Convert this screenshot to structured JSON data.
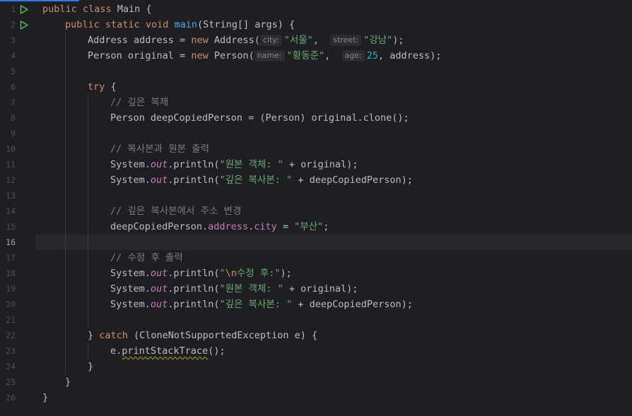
{
  "editor": {
    "accent_color": "#3574f0",
    "current_line": 16,
    "line_numbers": [
      "1",
      "2",
      "3",
      "4",
      "5",
      "6",
      "7",
      "8",
      "9",
      "10",
      "11",
      "12",
      "13",
      "14",
      "15",
      "16",
      "17",
      "18",
      "19",
      "20",
      "21",
      "22",
      "23",
      "24",
      "25",
      "26"
    ],
    "run_gutter_icons": [
      "run-class-icon",
      "run-main-icon"
    ],
    "lines": {
      "l1": {
        "kw1": "public",
        "kw2": "class",
        "name": "Main",
        "brace": " {"
      },
      "l2": {
        "kw1": "public",
        "kw2": "static",
        "kw3": "void",
        "fn": "main",
        "params": "(String[] args) {"
      },
      "l3": {
        "a": "Address address = ",
        "kw": "new",
        "b": " Address(",
        "hint1": "city:",
        "s1": "\"서울\"",
        "c": ", ",
        "hint2": "street:",
        "s2": "\"강남\"",
        "d": ");"
      },
      "l4": {
        "a": "Person original = ",
        "kw": "new",
        "b": " Person(",
        "hint1": "name:",
        "s1": "\"황동준\"",
        "c": ", ",
        "hint2": "age:",
        "n": "25",
        "d": ", address);"
      },
      "l6": {
        "kw": "try",
        "b": " {"
      },
      "l7": {
        "cmt": "// 깊은 복제"
      },
      "l8": {
        "code": "Person deepCopiedPerson = (Person) original.clone();"
      },
      "l10": {
        "cmt": "// 복사본과 원본 출력"
      },
      "l11": {
        "a": "System.",
        "f": "out",
        "b": ".println(",
        "s": "\"원본 객체: \"",
        "c": " + original);"
      },
      "l12": {
        "a": "System.",
        "f": "out",
        "b": ".println(",
        "s": "\"깊은 복사본: \"",
        "c": " + deepCopiedPerson);"
      },
      "l14": {
        "cmt": "// 깊은 복사본에서 주소 변경"
      },
      "l15": {
        "a": "deepCopiedPerson.",
        "f1": "address",
        "dot": ".",
        "f2": "city",
        "b": " = ",
        "s": "\"부산\"",
        "c": ";"
      },
      "l17": {
        "cmt": "// 수정 후 출력"
      },
      "l18": {
        "a": "System.",
        "f": "out",
        "b": ".println(",
        "q": "\"",
        "esc": "\\n",
        "s": "수정 후:\"",
        "c": ");"
      },
      "l19": {
        "a": "System.",
        "f": "out",
        "b": ".println(",
        "s": "\"원본 객체: \"",
        "c": " + original);"
      },
      "l20": {
        "a": "System.",
        "f": "out",
        "b": ".println(",
        "s": "\"깊은 복사본: \"",
        "c": " + deepCopiedPerson);"
      },
      "l22": {
        "a": "} ",
        "kw": "catch",
        "b": " (CloneNotSupportedException e) {"
      },
      "l23": {
        "a": "e.",
        "m": "printStackTrace",
        "b": "();"
      },
      "l24": {
        "code": "}"
      },
      "l25": {
        "code": "}"
      },
      "l26": {
        "code": "}"
      }
    }
  }
}
